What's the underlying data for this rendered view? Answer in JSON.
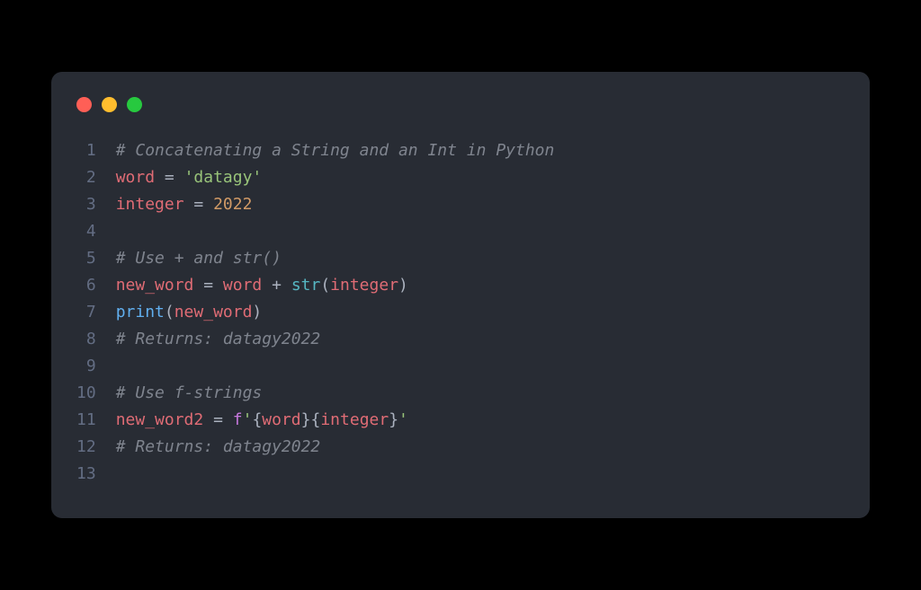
{
  "lineNumbers": [
    "1",
    "2",
    "3",
    "4",
    "5",
    "6",
    "7",
    "8",
    "9",
    "10",
    "11",
    "12",
    "13"
  ],
  "code": {
    "l1": {
      "comment": "# Concatenating a String and an Int in Python"
    },
    "l2": {
      "var": "word",
      "sp1": " ",
      "op": "=",
      "sp2": " ",
      "str": "'datagy'"
    },
    "l3": {
      "var": "integer",
      "sp1": " ",
      "op": "=",
      "sp2": " ",
      "num": "2022"
    },
    "l4": {},
    "l5": {
      "comment": "# Use + and str()"
    },
    "l6": {
      "var1": "new_word",
      "sp1": " ",
      "op1": "=",
      "sp2": " ",
      "var2": "word",
      "sp3": " ",
      "op2": "+",
      "sp4": " ",
      "fn": "str",
      "lp": "(",
      "arg": "integer",
      "rp": ")"
    },
    "l7": {
      "fn": "print",
      "lp": "(",
      "arg": "new_word",
      "rp": ")"
    },
    "l8": {
      "comment": "# Returns: datagy2022"
    },
    "l9": {},
    "l10": {
      "comment": "# Use f-strings"
    },
    "l11": {
      "var": "new_word2",
      "sp1": " ",
      "op": "=",
      "sp2": " ",
      "fpre": "f",
      "q1": "'",
      "lb1": "{",
      "fv1": "word",
      "rb1": "}",
      "lb2": "{",
      "fv2": "integer",
      "rb2": "}",
      "q2": "'"
    },
    "l12": {
      "comment": "# Returns: datagy2022"
    },
    "l13": {}
  }
}
